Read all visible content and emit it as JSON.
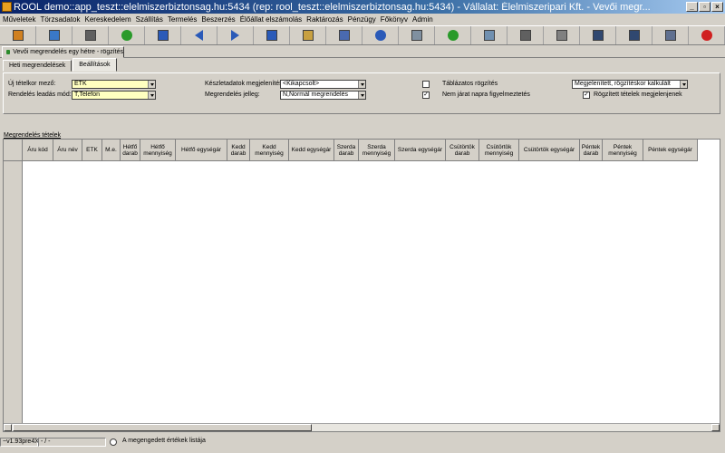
{
  "window": {
    "title": "ROOL demo::app_teszt::elelmiszerbiztonsag.hu:5434 (rep: rool_teszt::elelmiszerbiztonsag.hu:5434) - Vállalat: Élelmiszeripari Kft. - Vevői megr...",
    "buttons": {
      "minimize": "_",
      "restore": "▫",
      "close": "×"
    }
  },
  "menu": [
    "Műveletek",
    "Törzsadatok",
    "Kereskedelem",
    "Szállítás",
    "Termelés",
    "Beszerzés",
    "Élőállat elszámolás",
    "Raktározás",
    "Pénzügy",
    "Főkönyv",
    "Admin"
  ],
  "toolbar": {
    "icons": [
      "new-doc-icon",
      "open-icon",
      "save-icon",
      "refresh-icon",
      "first-record-icon",
      "previous-record-icon",
      "next-record-icon",
      "last-record-icon",
      "edit-icon",
      "database-icon",
      "info-icon",
      "form-icon",
      "recycle-icon",
      "search-icon",
      "list-icon",
      "print-icon",
      "grid-icon",
      "grid-settings-icon",
      "window-icon",
      "cancel-icon"
    ],
    "colors": [
      "#d08020",
      "#3a78c8",
      "#606060",
      "#2a9a2a",
      "#2a5ab8",
      "#2a5ab8",
      "#2a5ab8",
      "#2a5ab8",
      "#c8a040",
      "#4a6ab0",
      "#2a5ab8",
      "#8090a0",
      "#2a9a2a",
      "#7090b0",
      "#606060",
      "#808080",
      "#304870",
      "#304870",
      "#607090",
      "#d02020"
    ]
  },
  "doc_tab": {
    "label": "Vevői megrendelés egy hétre - rögzítés"
  },
  "tabs": [
    {
      "label": "Heti megrendelések"
    },
    {
      "label": "Beállítások"
    }
  ],
  "settings": {
    "new_item_field_label": "Új tételkor mező:",
    "new_item_field_value": "ETK",
    "order_mode_label": "Rendelés leadás mód:",
    "order_mode_value": "T,Telefon",
    "stock_display_label": "Készletadatok megjelenítés:",
    "stock_display_value": "<Kikapcsolt>",
    "order_type_label": "Megrendelés jelleg:",
    "order_type_value": "N,Normál megrendelés",
    "table_entry_label": "Táblázatos rögzítés",
    "table_entry_checked": false,
    "not_running_warning_label": "Nem járat napra figyelmeztetés",
    "not_running_warning_checked": true,
    "calc_mode_value": "Megjelenített, rögzítéskor kalkulált",
    "show_saved_items_label": "Rögzített tételek megjelenjenek",
    "show_saved_items_checked": true
  },
  "grid": {
    "title": "Megrendelés tételek",
    "columns": [
      "Áru kód",
      "Áru név",
      "ETK",
      "M.e.",
      "Hétfő darab",
      "Hétfő mennyiség",
      "Hétfő egységár",
      "Kedd darab",
      "Kedd mennyiség",
      "Kedd egységár",
      "Szerda darab",
      "Szerda mennyiség",
      "Szerda egységár",
      "Csütörtök darab",
      "Csütörtök mennyiség",
      "Csütörtök egységár",
      "Péntek darab",
      "Péntek mennyiség",
      "Péntek egységár"
    ]
  },
  "statusbar": {
    "version": "~v1.93pre4X",
    "state": "- / -",
    "allowed_values": "A megengedett értékek listája"
  }
}
